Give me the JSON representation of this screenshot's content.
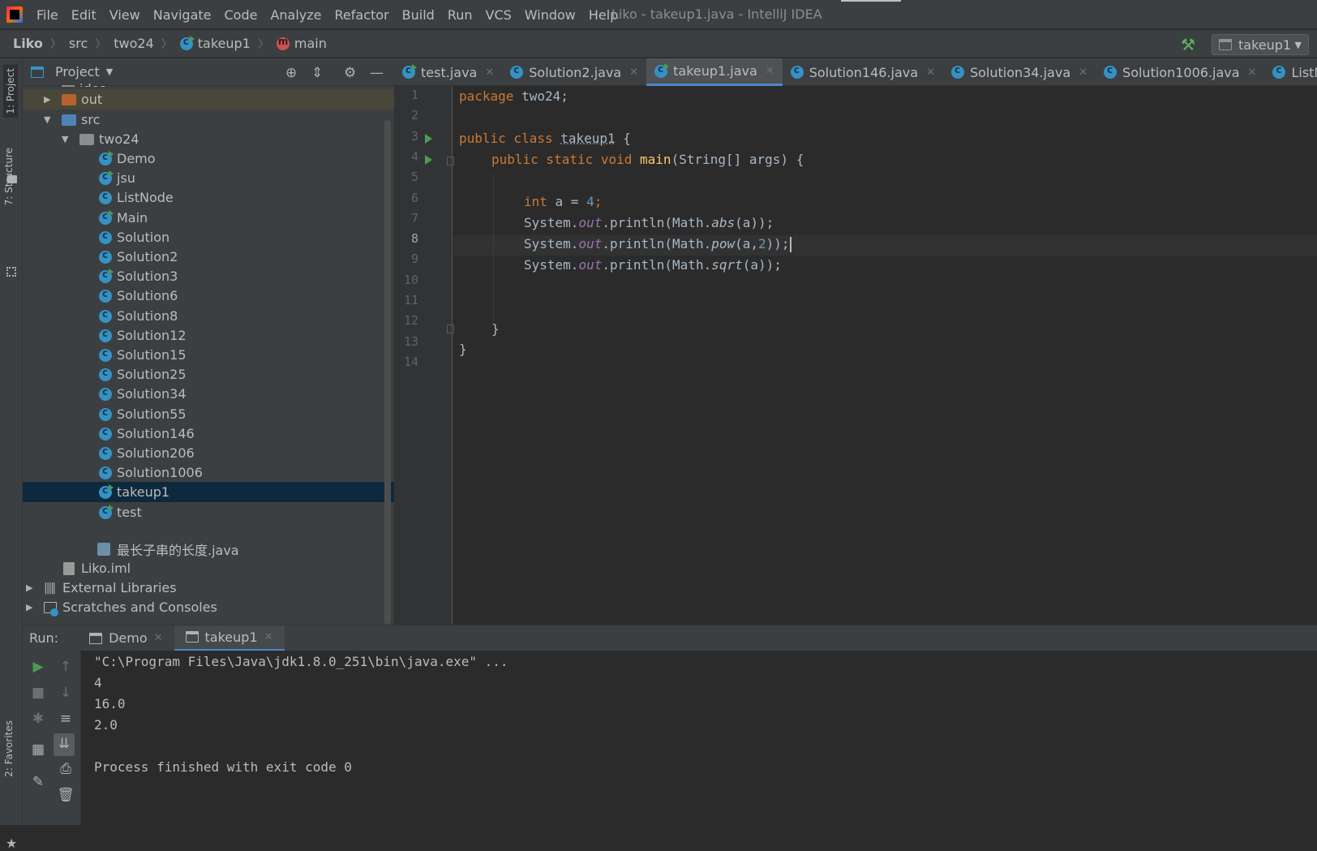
{
  "window": {
    "title": "Liko - takeup1.java - IntelliJ IDEA"
  },
  "menu": [
    "File",
    "Edit",
    "View",
    "Navigate",
    "Code",
    "Analyze",
    "Refactor",
    "Build",
    "Run",
    "VCS",
    "Window",
    "Help"
  ],
  "breadcrumb": {
    "project": "Liko",
    "src": "src",
    "pkg": "two24",
    "cls": "takeup1",
    "method": "main"
  },
  "run_config": {
    "label": "takeup1"
  },
  "side_tabs": {
    "project": "1: Project",
    "structure": "7: Structure",
    "favorites": "2: Favorites"
  },
  "project_panel": {
    "title": "Project",
    "partial_top": "idea",
    "out": "out",
    "src": "src",
    "pkg": "two24",
    "classes": [
      "Demo",
      "jsu",
      "ListNode",
      "Main",
      "Solution",
      "Solution2",
      "Solution3",
      "Solution6",
      "Solution8",
      "Solution12",
      "Solution15",
      "Solution25",
      "Solution34",
      "Solution55",
      "Solution146",
      "Solution206",
      "Solution1006",
      "takeup1",
      "test"
    ],
    "selected": "takeup1",
    "java_file": "最长子串的长度.java",
    "iml": "Liko.iml",
    "ext_libs": "External Libraries",
    "scratches": "Scratches and Consoles"
  },
  "editor_tabs": [
    {
      "label": "test.java",
      "active": false
    },
    {
      "label": "Solution2.java",
      "active": false
    },
    {
      "label": "takeup1.java",
      "active": true
    },
    {
      "label": "Solution146.java",
      "active": false
    },
    {
      "label": "Solution34.java",
      "active": false
    },
    {
      "label": "Solution1006.java",
      "active": false
    },
    {
      "label": "ListNode.java",
      "active": false
    }
  ],
  "line_numbers": [
    "1",
    "2",
    "3",
    "4",
    "5",
    "6",
    "7",
    "8",
    "9",
    "10",
    "11",
    "12",
    "13",
    "14"
  ],
  "current_line": 8,
  "code": {
    "l1_kw": "package",
    "l1_rest": " two24;",
    "l3_kw": "public class",
    "l3_name": "takeup1",
    "l3_rest": " {",
    "l4_kw": "public static void",
    "l4_fn": "main",
    "l4_rest": "(String[] args) {",
    "l6_kw": "int",
    "l6_mid": " a = ",
    "l6_num": "4",
    "l6_end": ";",
    "l7_a": "System.",
    "l7_out": "out",
    "l7_b": ".println(Math.",
    "l7_fn": "abs",
    "l7_c": "(a));",
    "l8_a": "System.",
    "l8_out": "out",
    "l8_b": ".println(Math.",
    "l8_fn": "pow",
    "l8_c": "(a,",
    "l8_num": "2",
    "l8_d": "));",
    "l9_a": "System.",
    "l9_out": "out",
    "l9_b": ".println(Math.",
    "l9_fn": "sqrt",
    "l9_c": "(a));",
    "l12": "}",
    "l13": "}"
  },
  "run_panel": {
    "label": "Run:",
    "tabs": [
      {
        "label": "Demo",
        "active": false
      },
      {
        "label": "takeup1",
        "active": true
      }
    ],
    "console": [
      "\"C:\\Program Files\\Java\\jdk1.8.0_251\\bin\\java.exe\" ...",
      "4",
      "16.0",
      "2.0",
      "",
      "Process finished with exit code 0"
    ]
  },
  "colors": {
    "accent": "#4a88c7",
    "keyword": "#cc7832",
    "function": "#ffc66d",
    "number": "#6897bb",
    "field": "#9876aa",
    "run_green": "#499c54"
  }
}
